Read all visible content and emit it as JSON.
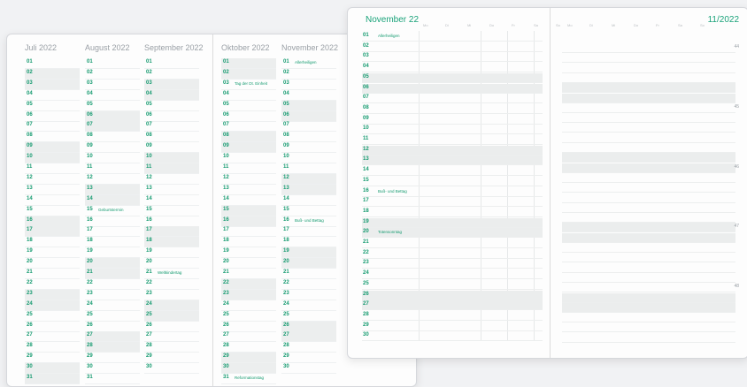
{
  "back_sheet": {
    "months": [
      {
        "name": "Juli 2022",
        "days": [
          "01",
          "02",
          "03",
          "04",
          "05",
          "06",
          "07",
          "08",
          "09",
          "10",
          "11",
          "12",
          "13",
          "14",
          "15",
          "16",
          "17",
          "18",
          "19",
          "20",
          "21",
          "22",
          "23",
          "24",
          "25",
          "26",
          "27",
          "28",
          "29",
          "30",
          "31"
        ],
        "weekend": [
          1,
          2,
          8,
          9,
          15,
          16,
          22,
          23,
          29,
          30
        ],
        "events": {}
      },
      {
        "name": "August 2022",
        "days": [
          "01",
          "02",
          "03",
          "04",
          "05",
          "06",
          "07",
          "08",
          "09",
          "10",
          "11",
          "12",
          "13",
          "14",
          "15",
          "16",
          "17",
          "18",
          "19",
          "20",
          "21",
          "22",
          "23",
          "24",
          "25",
          "26",
          "27",
          "28",
          "29",
          "30",
          "31"
        ],
        "weekend": [
          5,
          6,
          12,
          13,
          19,
          20,
          26,
          27
        ],
        "events": {
          "14": "Geburtstermin"
        }
      },
      {
        "name": "September 2022",
        "days": [
          "01",
          "02",
          "03",
          "04",
          "05",
          "06",
          "07",
          "08",
          "09",
          "10",
          "11",
          "12",
          "13",
          "14",
          "15",
          "16",
          "17",
          "18",
          "19",
          "20",
          "21",
          "22",
          "23",
          "24",
          "25",
          "26",
          "27",
          "28",
          "29",
          "30"
        ],
        "weekend": [
          2,
          3,
          9,
          10,
          16,
          17,
          23,
          24
        ],
        "events": {
          "20": "Weltkindertag"
        }
      },
      {
        "name": "Oktober 2022",
        "days": [
          "01",
          "02",
          "03",
          "04",
          "05",
          "06",
          "07",
          "08",
          "09",
          "10",
          "11",
          "12",
          "13",
          "14",
          "15",
          "16",
          "17",
          "18",
          "19",
          "20",
          "21",
          "22",
          "23",
          "24",
          "25",
          "26",
          "27",
          "28",
          "29",
          "30",
          "31"
        ],
        "weekend": [
          0,
          1,
          7,
          8,
          14,
          15,
          21,
          22,
          28,
          29
        ],
        "events": {
          "2": "Tag der Dt. Einheit",
          "30": "Reformationstag"
        }
      },
      {
        "name": "November 2022",
        "days": [
          "01",
          "02",
          "03",
          "04",
          "05",
          "06",
          "07",
          "08",
          "09",
          "10",
          "11",
          "12",
          "13",
          "14",
          "15",
          "16",
          "17",
          "18",
          "19",
          "20",
          "21",
          "22",
          "23",
          "24",
          "25",
          "26",
          "27",
          "28",
          "29",
          "30"
        ],
        "weekend": [
          4,
          5,
          11,
          12,
          18,
          19,
          25,
          26
        ],
        "events": {
          "0": "Allerheiligen",
          "15": "Buß- und Bettag"
        }
      }
    ]
  },
  "front_sheet": {
    "title": "November 22",
    "code": "11/2022",
    "weekday_heads": [
      "Mo",
      "Di",
      "Mi",
      "Do",
      "Fr",
      "Sa",
      "So"
    ],
    "days": [
      "01",
      "02",
      "03",
      "04",
      "05",
      "06",
      "07",
      "08",
      "09",
      "10",
      "11",
      "12",
      "13",
      "14",
      "15",
      "16",
      "17",
      "18",
      "19",
      "20",
      "21",
      "22",
      "23",
      "24",
      "25",
      "26",
      "27",
      "28",
      "29",
      "30"
    ],
    "weekend": [
      4,
      5,
      11,
      12,
      18,
      19,
      25,
      26
    ],
    "events": {
      "0": "Allerheiligen",
      "15": "Buß- und Bettag",
      "19": "Totensonntag"
    },
    "right_numbers": [
      "44",
      "45",
      "46",
      "47",
      "48"
    ]
  }
}
